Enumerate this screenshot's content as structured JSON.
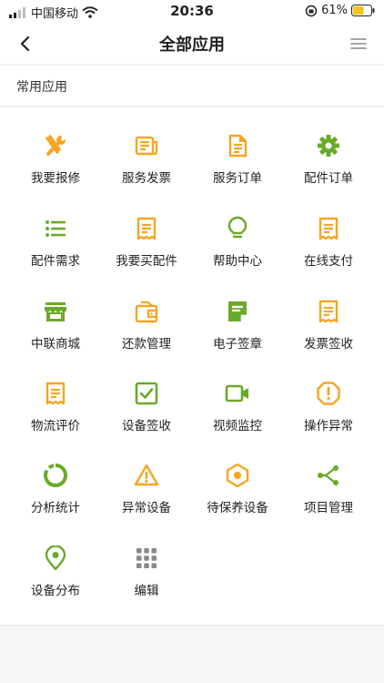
{
  "status_bar": {
    "carrier": "中国移动",
    "time": "20:36",
    "battery": "61%",
    "battery_level": 0.61
  },
  "header": {
    "title": "全部应用",
    "back_icon": "chevron-left-icon",
    "menu_icon": "hamburger-menu-icon"
  },
  "section": {
    "title": "常用应用"
  },
  "colors": {
    "orange": "#f5a623",
    "green": "#6aaa2a",
    "gray": "#888888"
  },
  "apps": [
    {
      "label": "我要报修",
      "icon": "tools-icon"
    },
    {
      "label": "服务发票",
      "icon": "newspaper-icon"
    },
    {
      "label": "服务订单",
      "icon": "document-icon"
    },
    {
      "label": "配件订单",
      "icon": "gear-icon"
    },
    {
      "label": "配件需求",
      "icon": "list-icon"
    },
    {
      "label": "我要买配件",
      "icon": "receipt-icon"
    },
    {
      "label": "帮助中心",
      "icon": "lightbulb-icon"
    },
    {
      "label": "在线支付",
      "icon": "receipt-icon"
    },
    {
      "label": "中联商城",
      "icon": "store-icon"
    },
    {
      "label": "还款管理",
      "icon": "wallet-icon"
    },
    {
      "label": "电子签章",
      "icon": "note-icon"
    },
    {
      "label": "发票签收",
      "icon": "receipt-icon"
    },
    {
      "label": "物流评价",
      "icon": "receipt-icon"
    },
    {
      "label": "设备签收",
      "icon": "checkbox-icon"
    },
    {
      "label": "视频监控",
      "icon": "video-camera-icon"
    },
    {
      "label": "操作异常",
      "icon": "alert-octagon-icon"
    },
    {
      "label": "分析统计",
      "icon": "donut-chart-icon"
    },
    {
      "label": "异常设备",
      "icon": "warning-triangle-icon"
    },
    {
      "label": "待保养设备",
      "icon": "hex-nut-icon"
    },
    {
      "label": "项目管理",
      "icon": "share-nodes-icon"
    },
    {
      "label": "设备分布",
      "icon": "location-pin-icon"
    },
    {
      "label": "编辑",
      "icon": "grid-dots-icon"
    }
  ]
}
